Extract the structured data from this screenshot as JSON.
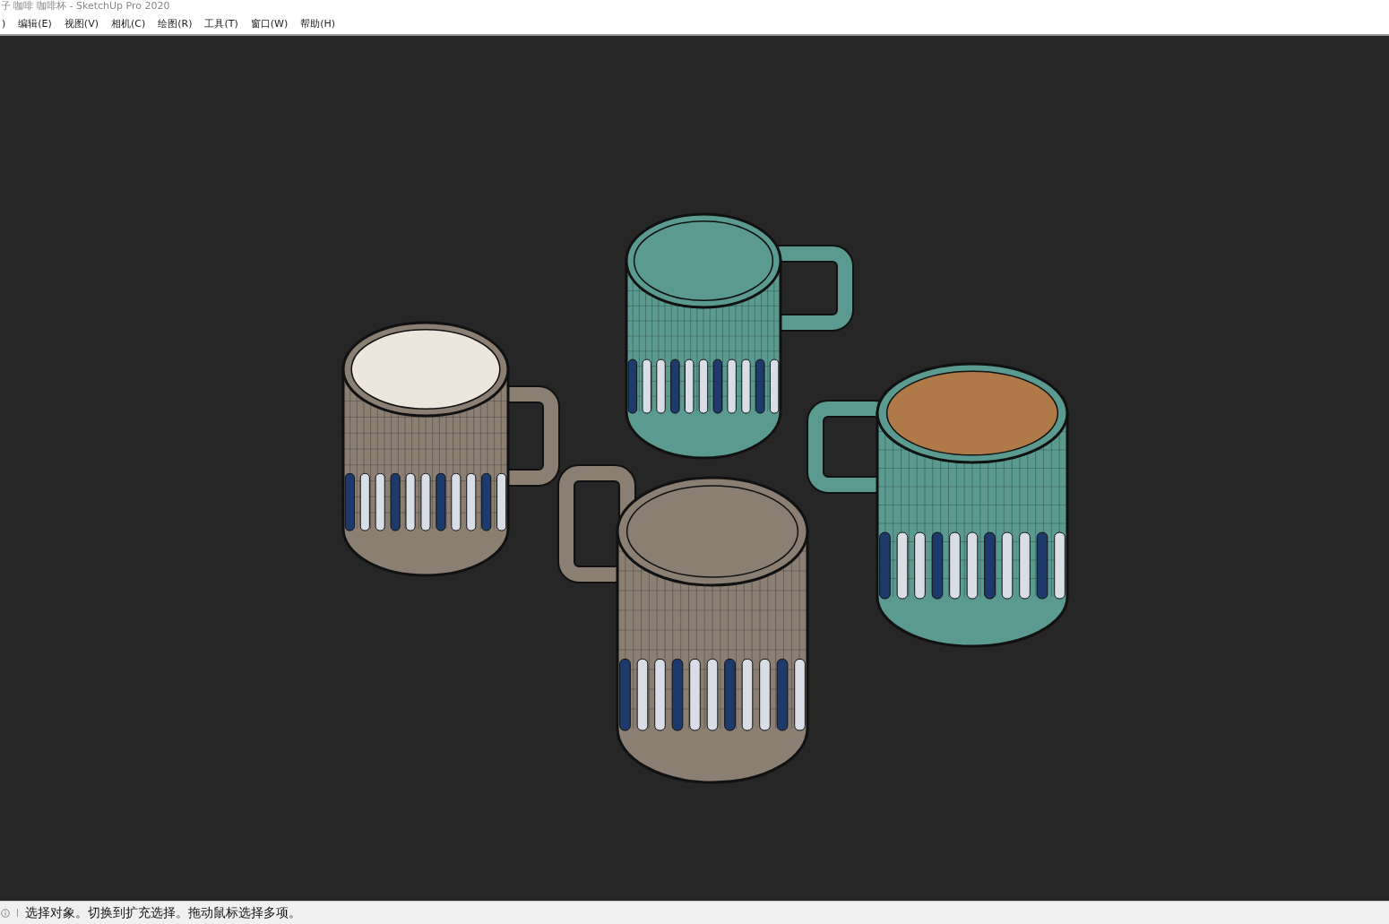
{
  "window": {
    "title": "子 咖啡 咖啡杯 - SketchUp Pro 2020"
  },
  "menu": {
    "items": [
      {
        "label": ")"
      },
      {
        "label": "编辑(E)"
      },
      {
        "label": "视图(V)"
      },
      {
        "label": "相机(C)"
      },
      {
        "label": "绘图(R)"
      },
      {
        "label": "工具(T)"
      },
      {
        "label": "窗口(W)"
      },
      {
        "label": "帮助(H)"
      }
    ]
  },
  "status_bar": {
    "text": "选择对象。切换到扩充选择。拖动鼠标选择多项。"
  }
}
